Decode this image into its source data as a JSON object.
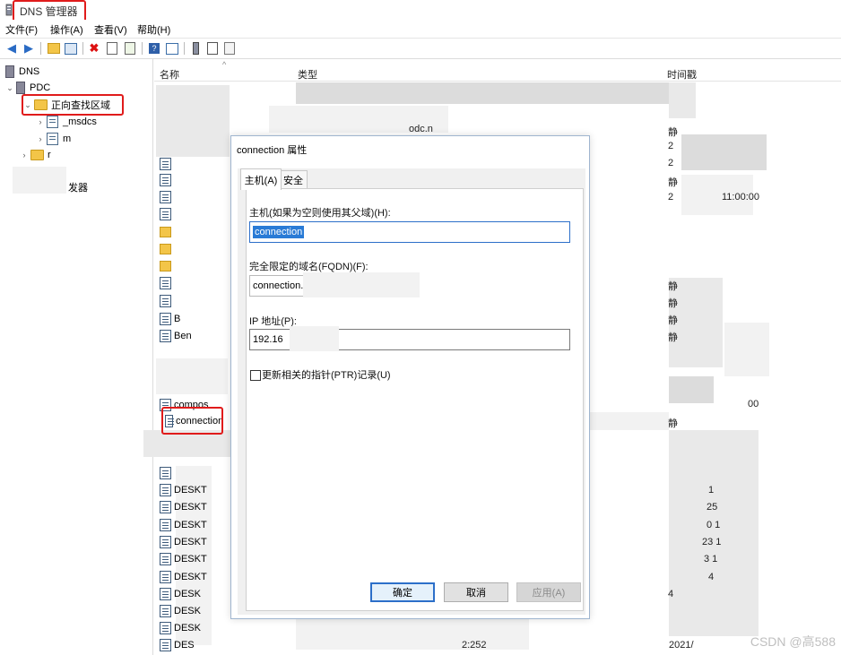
{
  "window": {
    "title": "DNS 管理器"
  },
  "menu": {
    "items": [
      "文件(F)",
      "操作(A)",
      "查看(V)",
      "帮助(H)"
    ]
  },
  "tree": {
    "items": [
      {
        "label": "DNS"
      },
      {
        "label": "PDC"
      },
      {
        "label": "正向查找区域"
      },
      {
        "label": "_msdcs"
      },
      {
        "label": "m"
      },
      {
        "label": "r"
      },
      {
        "label": "发器"
      }
    ]
  },
  "list": {
    "columns": {
      "name": "名称",
      "type": "类型",
      "timestamp": "时间戳"
    },
    "partial_cells": [
      "odc.n"
    ],
    "rows": [
      "B",
      "Ben",
      "compos",
      "connection",
      "DESKT",
      "DESKT",
      "DESKT",
      "DESKT",
      "DESKT",
      "DESKT",
      "DESK",
      "DESK",
      "DESK",
      "DES"
    ],
    "timestamps": [
      "静",
      "2",
      "2",
      "静",
      "2",
      "11:00:00",
      "静",
      "静",
      "静",
      "静",
      "00",
      "静",
      "1",
      "25",
      "0 1",
      "23 1",
      "3 1",
      "4",
      "4"
    ],
    "bottom_partials": [
      "2:252",
      "2021/"
    ]
  },
  "dialog": {
    "title": "connection 属性",
    "tabs": [
      "主机(A)",
      "安全"
    ],
    "host_label": "主机(如果为空则使用其父域)(H):",
    "host_value": "connection",
    "fqdn_label": "完全限定的域名(FQDN)(F):",
    "fqdn_value": "connection.",
    "ip_label": "IP 地址(P):",
    "ip_value": "192.16",
    "ptr_label": "更新相关的指针(PTR)记录(U)",
    "ok": "确定",
    "cancel": "取消",
    "apply": "应用(A)"
  },
  "watermark": "CSDN @高588",
  "colors": {
    "annotation_red": "#e01b1b",
    "selection_blue": "#2a7bd6",
    "dialog_border": "#9fb5cf"
  }
}
